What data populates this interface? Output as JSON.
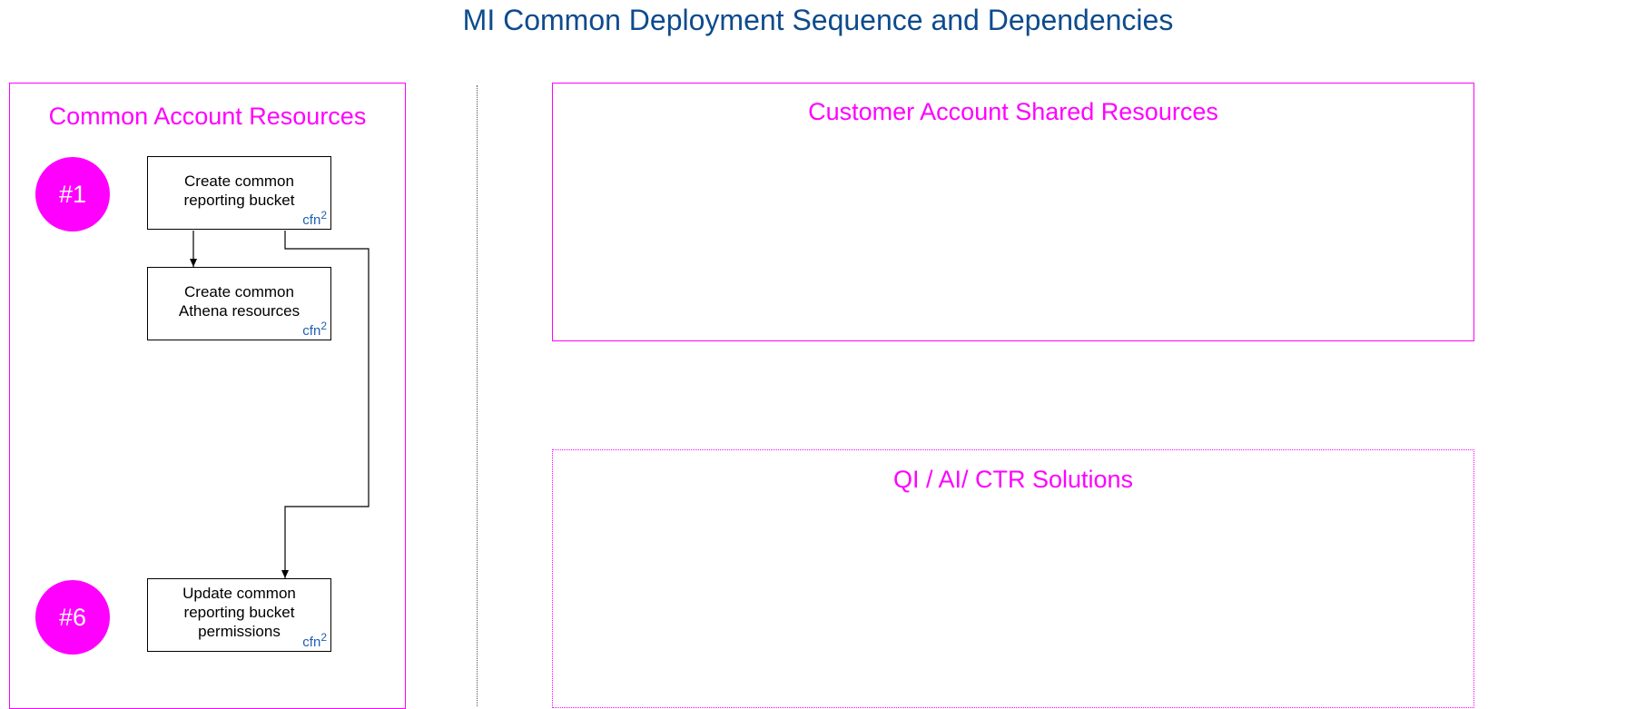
{
  "title": "MI Common Deployment Sequence and Dependencies",
  "panels": {
    "common": {
      "title": "Common Account Resources"
    },
    "customer": {
      "title": "Customer Account Shared Resources"
    },
    "solutions": {
      "title": "QI / AI/ CTR Solutions"
    }
  },
  "steps": [
    {
      "label": "#1"
    },
    {
      "label": "#6"
    }
  ],
  "tasks": [
    {
      "text": "Create common\nreporting bucket",
      "tag": "cfn",
      "tag_sup": "2"
    },
    {
      "text": "Create common\nAthena resources",
      "tag": "cfn",
      "tag_sup": "2"
    },
    {
      "text": "Update common\nreporting bucket\npermissions",
      "tag": "cfn",
      "tag_sup": "2"
    }
  ],
  "colors": {
    "title": "#0d4b8e",
    "accent": "#ff00ff",
    "tag": "#1f5fb4"
  }
}
